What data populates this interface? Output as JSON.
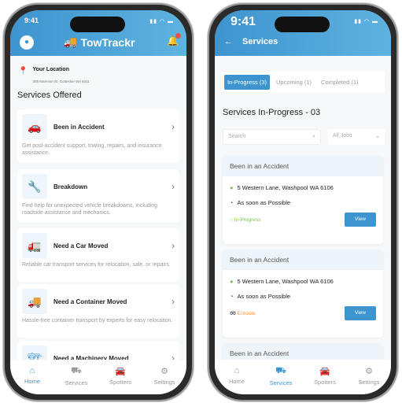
{
  "left": {
    "time": "9:41",
    "brand": "TowTrackr",
    "location": {
      "label": "Your Location",
      "address": "305 Marmion St, Cottesloe WA 6011"
    },
    "section_title": "Services Offered",
    "services": [
      {
        "title": "Been in Accident",
        "desc": "Get post-accident support, towing, repairs, and insurance assistance.",
        "icon": "car-crash-icon"
      },
      {
        "title": "Breakdown",
        "desc": "Find help for unexpected vehicle breakdowns, including roadside assistance and mechanics.",
        "icon": "mechanic-icon"
      },
      {
        "title": "Need a Car Moved",
        "desc": "Reliable car transport services for relocation, sale, or repairs.",
        "icon": "tow-truck-icon"
      },
      {
        "title": "Need a Container Moved",
        "desc": "Hassle-free container transport by experts for easy relocation.",
        "icon": "container-truck-icon"
      },
      {
        "title": "Need a Machinery Moved",
        "desc": "",
        "icon": "machinery-icon"
      }
    ],
    "nav": [
      "Home",
      "Services",
      "Spotters",
      "Settings"
    ],
    "active_nav": "Home"
  },
  "right": {
    "time": "9:41",
    "title": "Services",
    "tabs": [
      "In-Progress (3)",
      "Upcoming (1)",
      "Completed (1)"
    ],
    "active_tab": "In-Progress (3)",
    "heading": "Services In-Progress - 03",
    "search_placeholder": "Search",
    "filter": "All Jobs",
    "jobs": [
      {
        "title": "Been in an Accident",
        "address": "5 Western Lane, Washpool WA 6106",
        "time": "As soon as Possible",
        "status": "In-Progress",
        "status_color": "#7cc04b",
        "button": "View"
      },
      {
        "title": "Been in an Accident",
        "address": "5 Western Lane, Washpool WA 6106",
        "time": "As soon as Possible",
        "status": "Enroute",
        "status_color": "#f0953a",
        "button": "View"
      },
      {
        "title": "Been in an Accident"
      }
    ],
    "nav": [
      "Home",
      "Services",
      "Spotters",
      "Settings"
    ],
    "active_nav": "Services"
  },
  "colors": {
    "primary": "#3d94cf"
  }
}
